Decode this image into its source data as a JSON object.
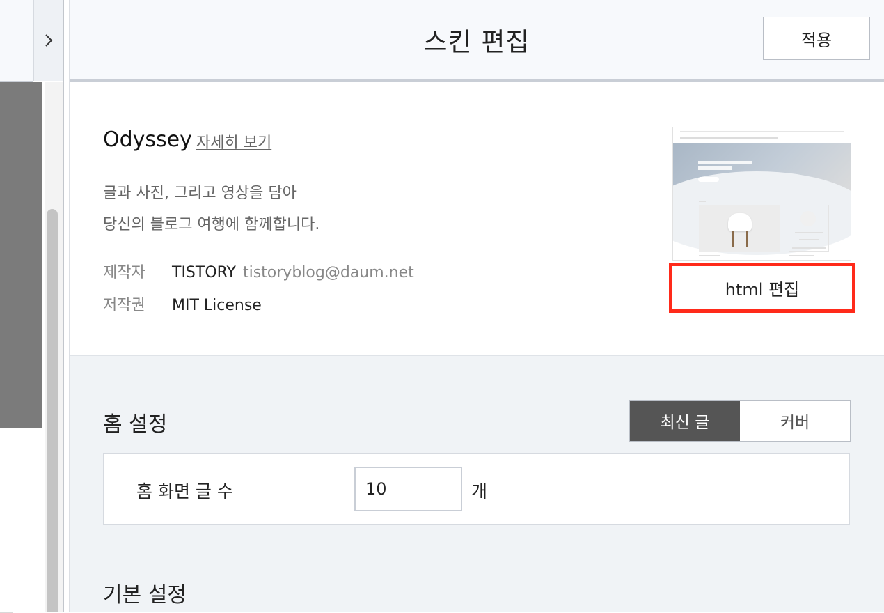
{
  "header": {
    "title": "스킨 편집",
    "apply_label": "적용"
  },
  "skin": {
    "name": "Odyssey",
    "detail_link": "자세히 보기",
    "description_line1": "글과 사진, 그리고 영상을 담아",
    "description_line2": "당신의 블로그 여행에 함께합니다.",
    "author_label": "제작자",
    "author_name": "TISTORY",
    "author_email": "tistoryblog@daum.net",
    "license_label": "저작권",
    "license_value": "MIT License",
    "html_edit_label": "html 편집"
  },
  "home_settings": {
    "title": "홈 설정",
    "toggle_options": [
      "최신 글",
      "커버"
    ],
    "selected_option": "최신 글",
    "post_count_label": "홈 화면 글 수",
    "post_count_value": "10",
    "post_count_unit": "개"
  },
  "basic_settings": {
    "title": "기본 설정"
  },
  "icons": {
    "sidebar_toggle": "chevron-right-icon"
  },
  "colors": {
    "highlight_border": "#ff2a1a",
    "toggle_active": "#555555",
    "settings_bg": "#f0f3f6"
  }
}
